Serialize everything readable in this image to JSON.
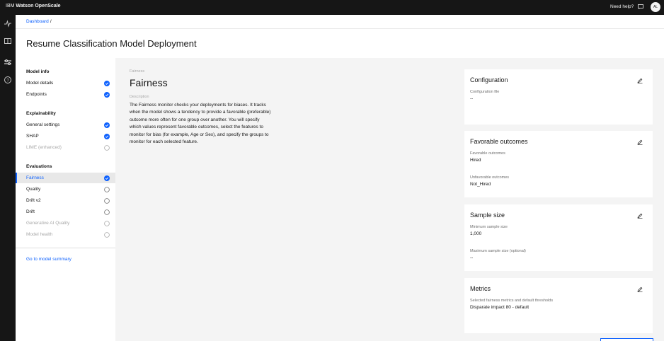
{
  "app": {
    "brand_ibm": "IBM",
    "brand_product": "Watson OpenScale",
    "help": "Need help?",
    "avatar_initials": "AL"
  },
  "breadcrumb": {
    "root": "Dashboard",
    "separator": "/"
  },
  "page": {
    "title": "Resume Classification Model Deployment"
  },
  "sidebar": {
    "groups": [
      {
        "title": "Model info",
        "items": [
          {
            "label": "Model details",
            "status": "complete"
          },
          {
            "label": "Endpoints",
            "status": "complete"
          }
        ]
      },
      {
        "title": "Explainability",
        "items": [
          {
            "label": "General settings",
            "status": "complete"
          },
          {
            "label": "SHAP",
            "status": "complete"
          },
          {
            "label": "LIME (enhanced)",
            "status": "disabled"
          }
        ]
      },
      {
        "title": "Evaluations",
        "items": [
          {
            "label": "Fairness",
            "status": "complete",
            "active": true
          },
          {
            "label": "Quality",
            "status": "incomplete"
          },
          {
            "label": "Drift v2",
            "status": "incomplete"
          },
          {
            "label": "Drift",
            "status": "incomplete"
          },
          {
            "label": "Generative AI Quality",
            "status": "disabled"
          },
          {
            "label": "Model health",
            "status": "disabled"
          }
        ]
      }
    ],
    "summary_link": "Go to model summary"
  },
  "section": {
    "eyebrow": "Fairness",
    "title": "Fairness",
    "description_label": "Description",
    "description": "The Fairness monitor checks your deployments for biases. It tracks when the model shows a tendency to provide a favorable (preferable) outcome more often for one group over another. You will specify which values represent favorable outcomes, select the features to monitor for bias (for example, Age or Sex), and specify the groups to monitor for each selected feature."
  },
  "cards": {
    "configuration": {
      "title": "Configuration",
      "file_label": "Configuration file",
      "file_value": "--"
    },
    "favorable": {
      "title": "Favorable outcomes",
      "fav_label": "Favorable outcomes",
      "fav_value": "Hired",
      "unfav_label": "Unfavorable outcomes",
      "unfav_value": "Not_Hired"
    },
    "sample": {
      "title": "Sample size",
      "min_label": "Minimum sample size",
      "min_value": "1,000",
      "max_label": "Maximum sample size (optional)",
      "max_value": "--"
    },
    "metrics": {
      "title": "Metrics",
      "sel_label": "Selected fairness metrics and default thresholds",
      "sel_value": "Disparate impact 80 - default"
    }
  },
  "colors": {
    "accent": "#0f62fe",
    "topbar": "#161616",
    "panel": "#f4f4f4"
  }
}
